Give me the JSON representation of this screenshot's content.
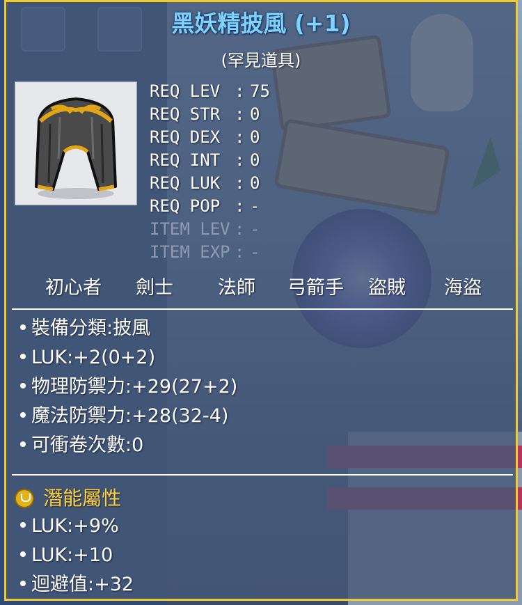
{
  "item": {
    "name": "黑妖精披風 (+1)",
    "rarity": "(罕見道具)",
    "icon": "cape-icon"
  },
  "requirements": [
    {
      "label": "REQ LEV",
      "value": "75",
      "dim": false
    },
    {
      "label": "REQ STR",
      "value": "0",
      "dim": false
    },
    {
      "label": "REQ DEX",
      "value": "0",
      "dim": false
    },
    {
      "label": "REQ INT",
      "value": "0",
      "dim": false
    },
    {
      "label": "REQ LUK",
      "value": "0",
      "dim": false
    },
    {
      "label": "REQ POP",
      "value": "-",
      "dim": false
    },
    {
      "label": "ITEM LEV",
      "value": "-",
      "dim": true
    },
    {
      "label": "ITEM EXP",
      "value": "-",
      "dim": true
    }
  ],
  "jobs": [
    "初心者",
    "劍士",
    "法師",
    "弓箭手",
    "盜賊",
    "海盜"
  ],
  "stats": [
    "裝備分類:披風",
    "LUK:+2(0+2)",
    "物理防禦力:+29(27+2)",
    "魔法防禦力:+28(32-4)",
    "可衝卷次數:0"
  ],
  "potential": {
    "label": "潛能屬性",
    "icon": "potential-u-icon",
    "lines": [
      "LUK:+9%",
      "LUK:+10",
      "迴避值:+32"
    ]
  },
  "colors": {
    "border": "#f1ca2e",
    "title": "#7fd2ff",
    "potential_label": "#ffd23a"
  }
}
